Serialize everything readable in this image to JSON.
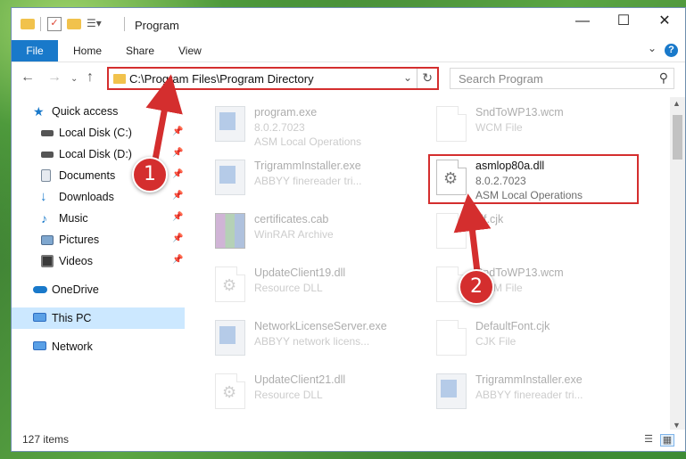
{
  "window": {
    "title": "Program"
  },
  "ribbon": {
    "file": "File",
    "home": "Home",
    "share": "Share",
    "view": "View"
  },
  "address": {
    "path": "C:\\Program Files\\Program Directory"
  },
  "search": {
    "placeholder": "Search Program"
  },
  "sidebar": {
    "items": [
      {
        "label": "Quick access",
        "icon": "star-icon",
        "pinned": false
      },
      {
        "label": "Local Disk (C:)",
        "icon": "drive-icon",
        "pinned": true
      },
      {
        "label": "Local Disk (D:)",
        "icon": "drive-icon",
        "pinned": true
      },
      {
        "label": "Documents",
        "icon": "documents-icon",
        "pinned": true
      },
      {
        "label": "Downloads",
        "icon": "download-icon",
        "pinned": true
      },
      {
        "label": "Music",
        "icon": "music-icon",
        "pinned": true
      },
      {
        "label": "Pictures",
        "icon": "pictures-icon",
        "pinned": true
      },
      {
        "label": "Videos",
        "icon": "videos-icon",
        "pinned": true
      },
      {
        "label": "OneDrive",
        "icon": "cloud-icon",
        "pinned": false
      },
      {
        "label": "This PC",
        "icon": "computer-icon",
        "pinned": false,
        "selected": true
      },
      {
        "label": "Network",
        "icon": "network-icon",
        "pinned": false
      }
    ]
  },
  "files": [
    {
      "name": "program.exe",
      "line1": "8.0.2.7023",
      "line2": "ASM Local Operations",
      "icon": "exe-icon"
    },
    {
      "name": "SndToWP13.wcm",
      "line1": "WCM File",
      "line2": "",
      "icon": "document-icon"
    },
    {
      "name": "TrigrammInstaller.exe",
      "line1": "ABBYY finereader tri...",
      "line2": "",
      "icon": "installer-icon"
    },
    {
      "name": "asmlop80a.dll",
      "line1": "8.0.2.7023",
      "line2": "ASM Local Operations",
      "icon": "dll-gear-icon",
      "highlighted": true
    },
    {
      "name": "certificates.cab",
      "line1": "WinRAR Archive",
      "line2": "",
      "icon": "archive-icon"
    },
    {
      "name": "cif.cjk",
      "line1": "",
      "line2": "",
      "icon": "document-icon"
    },
    {
      "name": "UpdateClient19.dll",
      "line1": "Resource DLL",
      "line2": "",
      "icon": "dll-gear-icon"
    },
    {
      "name": "SndToWP13.wcm",
      "line1": "WCM File",
      "line2": "",
      "icon": "document-icon"
    },
    {
      "name": "NetworkLicenseServer.exe",
      "line1": "ABBYY network licens...",
      "line2": "",
      "icon": "installer-icon"
    },
    {
      "name": "DefaultFont.cjk",
      "line1": "CJK File",
      "line2": "",
      "icon": "document-icon"
    },
    {
      "name": "UpdateClient21.dll",
      "line1": "Resource DLL",
      "line2": "",
      "icon": "dll-gear-icon"
    },
    {
      "name": "TrigrammInstaller.exe",
      "line1": "ABBYY finereader tri...",
      "line2": "",
      "icon": "installer-icon"
    }
  ],
  "status": {
    "items": "127 items"
  },
  "annotations": {
    "step1": "1",
    "step2": "2",
    "color": "#d42e2e"
  },
  "colors": {
    "accent": "#1979ca",
    "selection": "#cce8ff",
    "annotation": "#d42e2e"
  }
}
